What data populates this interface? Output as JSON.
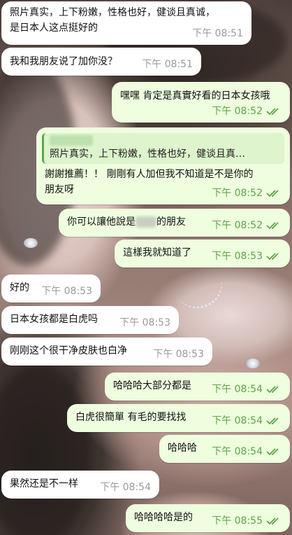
{
  "chat": {
    "messages": [
      {
        "dir": "in",
        "lines": [
          "照片真实，上下粉嫩，性格也好，健谈且真诚，",
          "是日本人这点挺好的"
        ],
        "time": "下午 08:51"
      },
      {
        "dir": "in",
        "lines": [
          "我和我朋友说了加你没？"
        ],
        "time": "下午 08:51"
      },
      {
        "dir": "out",
        "lines": [
          "嘿嘿 肯定是真實好看的日本女孩哦"
        ],
        "time": "下午 08:52"
      },
      {
        "dir": "out",
        "quote": "照片真实，上下粉嫩，性格也好，健谈且真…",
        "lines": [
          "謝謝推薦！！ 剛剛有人加但我不知道是不是你的",
          "朋友呀"
        ],
        "time": "下午 08:52"
      },
      {
        "dir": "out",
        "lines_a": "你可以讓他說是",
        "lines_b": "的朋友",
        "time": "下午 08:52"
      },
      {
        "dir": "out",
        "lines": [
          "這樣我就知道了"
        ],
        "time": "下午 08:53"
      },
      {
        "dir": "in",
        "lines": [
          "好的"
        ],
        "time": "下午 08:53"
      },
      {
        "dir": "in",
        "lines": [
          "日本女孩都是白虎吗"
        ],
        "time": "下午 08:53"
      },
      {
        "dir": "in",
        "lines": [
          "刚刚这个很干净皮肤也白净"
        ],
        "time": "下午 08:53"
      },
      {
        "dir": "out",
        "lines": [
          "哈哈哈大部分都是"
        ],
        "time": "下午 08:54"
      },
      {
        "dir": "out",
        "lines": [
          "白虎很簡單 有毛的要找找"
        ],
        "time": "下午 08:54"
      },
      {
        "dir": "out",
        "lines": [
          "哈哈哈"
        ],
        "time": "下午 08:54"
      },
      {
        "dir": "in",
        "lines": [
          "果然还是不一样"
        ],
        "time": "下午 08:54"
      },
      {
        "dir": "out",
        "lines": [
          "哈哈哈哈是的"
        ],
        "time": "下午 08:55"
      }
    ],
    "icons": {
      "read_receipt": "double-check-icon"
    },
    "colors": {
      "incoming_bg": "#ffffff",
      "outgoing_bg": "#eefedf",
      "outgoing_time": "#5da546",
      "incoming_time": "#9a9a9a"
    }
  }
}
